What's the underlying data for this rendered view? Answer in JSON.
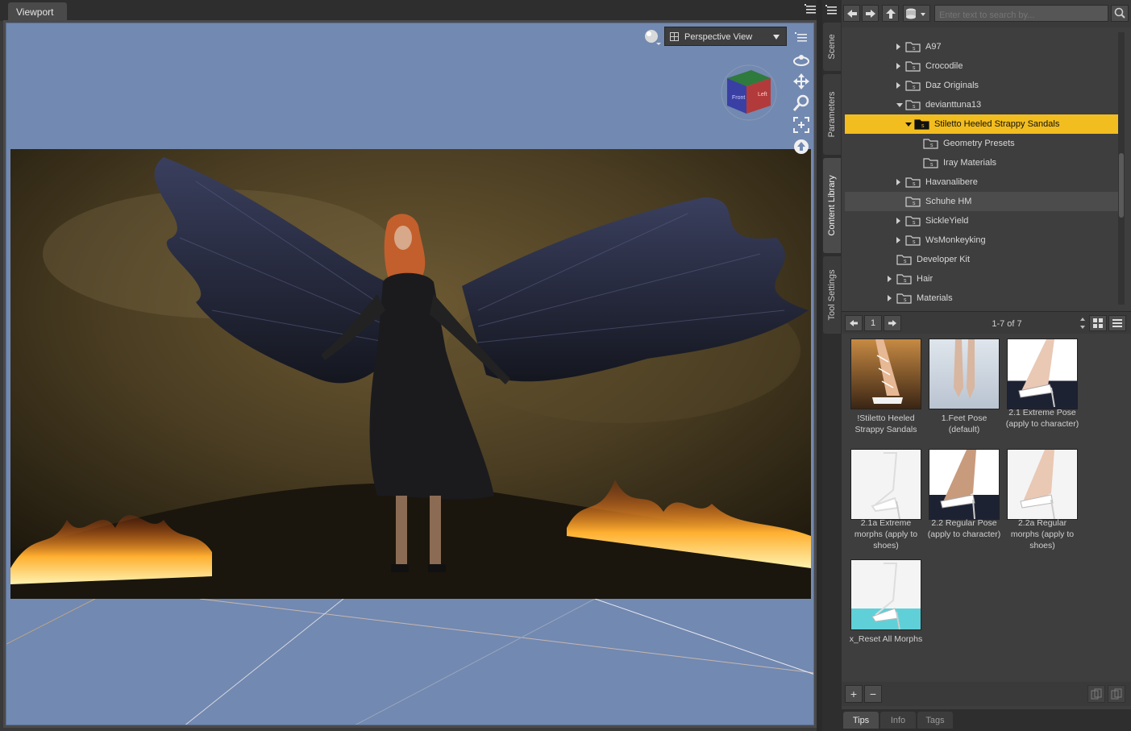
{
  "viewport": {
    "tab_label": "Viewport",
    "camera_label": "Perspective View",
    "cube_face_labels": [
      "Front",
      "Left"
    ]
  },
  "side_tabs": [
    {
      "label": "Scene",
      "active": false
    },
    {
      "label": "Parameters",
      "active": false
    },
    {
      "label": "Content Library",
      "active": true
    },
    {
      "label": "Tool Settings",
      "active": false
    }
  ],
  "library": {
    "search_placeholder": "Enter text to search by...",
    "tree": [
      {
        "label": "A97",
        "expander": "closed"
      },
      {
        "label": "Crocodile",
        "expander": "closed"
      },
      {
        "label": "Daz Originals",
        "expander": "closed"
      },
      {
        "label": "devianttuna13",
        "expander": "open"
      },
      {
        "label": "Stiletto Heeled Strappy Sandals",
        "expander": "open",
        "selected": true
      },
      {
        "label": "Geometry Presets",
        "expander": "none"
      },
      {
        "label": "Iray Materials",
        "expander": "none"
      },
      {
        "label": "Havanalibere",
        "expander": "closed"
      },
      {
        "label": "Schuhe HM",
        "expander": "none",
        "highlighted": true
      },
      {
        "label": "SickleYield",
        "expander": "closed"
      },
      {
        "label": "WsMonkeyking",
        "expander": "closed"
      },
      {
        "label": "Developer Kit",
        "expander": "none"
      },
      {
        "label": "Hair",
        "expander": "closed"
      },
      {
        "label": "Materials",
        "expander": "closed"
      }
    ],
    "page_number": "1",
    "result_count": "1-7 of 7",
    "items": [
      {
        "caption": "!Stiletto Heeled Strappy Sandals"
      },
      {
        "caption": "1.Feet Pose (default)"
      },
      {
        "caption": "2.1 Extreme Pose (apply to character)"
      },
      {
        "caption": "2.1a Extreme morphs (apply to shoes)"
      },
      {
        "caption": "2.2 Regular Pose (apply to character)"
      },
      {
        "caption": "2.2a Regular morphs (apply to shoes)"
      },
      {
        "caption": "x_Reset All Morphs"
      }
    ],
    "add_label": "+",
    "remove_label": "−"
  },
  "info_tabs": [
    {
      "label": "Tips",
      "active": true
    },
    {
      "label": "Info",
      "active": false
    },
    {
      "label": "Tags",
      "active": false
    }
  ],
  "colors": {
    "viewport_bg": "#7289b1",
    "selection": "#f2bd1f",
    "panel": "#3e3e3e"
  }
}
